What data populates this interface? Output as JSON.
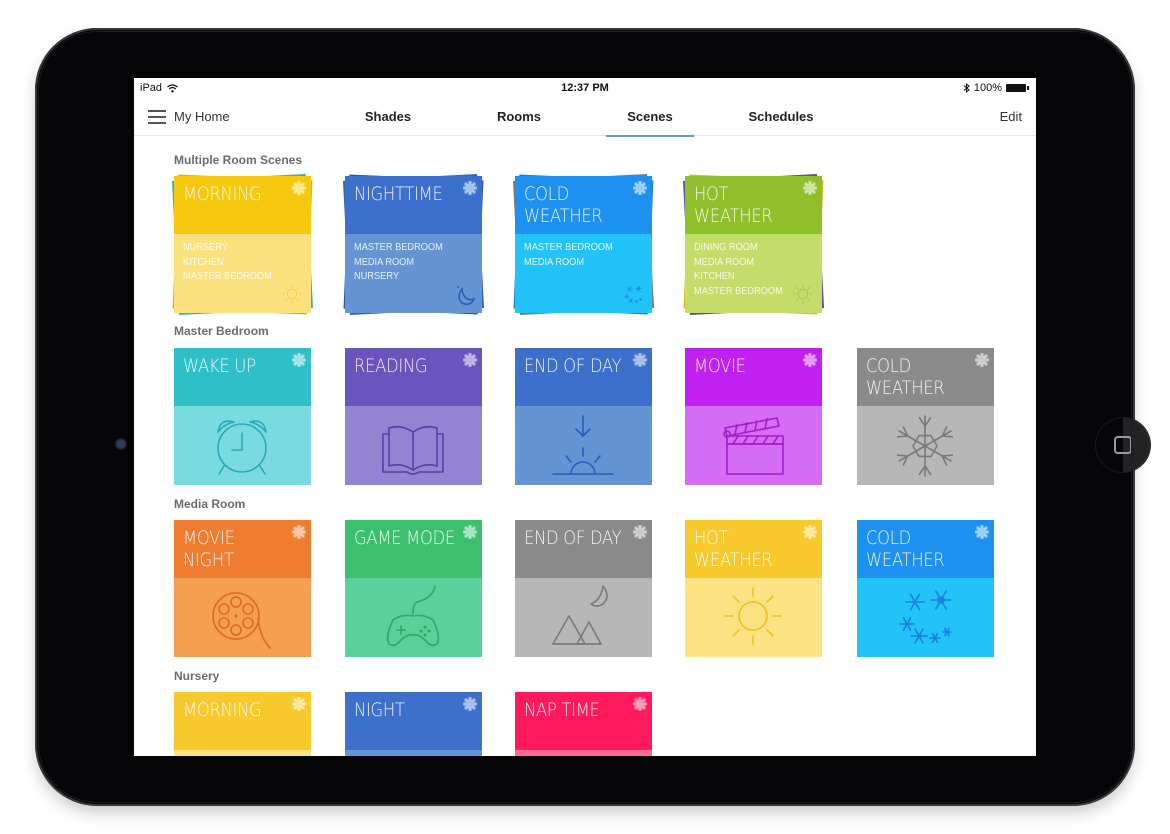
{
  "device": {
    "model": "iPad"
  },
  "statusbar": {
    "carrier": "iPad",
    "time": "12:37 PM",
    "battery": "100%"
  },
  "navbar": {
    "home_label": "My Home",
    "tabs": [
      {
        "label": "Shades",
        "active": false
      },
      {
        "label": "Rooms",
        "active": false
      },
      {
        "label": "Scenes",
        "active": true
      },
      {
        "label": "Schedules",
        "active": false
      }
    ],
    "edit_label": "Edit"
  },
  "sections": [
    {
      "label": "Multiple Room Scenes",
      "scenes": [
        {
          "title": [
            "MORNING"
          ],
          "rooms": [
            "NURSERY",
            "KITCHEN",
            "MASTER BEDROOM"
          ],
          "icon": "sun-icon",
          "header_color": "#f6c90e",
          "body_color": "#fbe17e",
          "back_colors": [
            "#2bb7c2",
            "#dcae1a"
          ]
        },
        {
          "title": [
            "NIGHTTIME"
          ],
          "rooms": [
            "MASTER BEDROOM",
            "MEDIA ROOM",
            "NURSERY"
          ],
          "icon": "moon-icon",
          "header_color": "#3d6fcc",
          "body_color": "#6494d4",
          "back_colors": [
            "#3563b8",
            "#2f59a8"
          ]
        },
        {
          "title": [
            "COLD",
            "WEATHER"
          ],
          "rooms": [
            "MASTER BEDROOM",
            "MEDIA ROOM"
          ],
          "icon": "snowflakes-icon",
          "header_color": "#1e90f0",
          "body_color": "#22c3f8",
          "back_colors": [
            "#7a7a7a",
            "#1a80e0"
          ]
        },
        {
          "title": [
            "HOT",
            "WEATHER"
          ],
          "rooms": [
            "DINING ROOM",
            "MEDIA ROOM",
            "KITCHEN",
            "MASTER BEDROOM"
          ],
          "icon": "sun-icon",
          "header_color": "#8fbf2a",
          "body_color": "#c4dc6a",
          "back_colors": [
            "#5b4db3",
            "#e2b51c"
          ]
        }
      ]
    },
    {
      "label": "Master Bedroom",
      "scenes": [
        {
          "title": [
            "WAKE UP"
          ],
          "icon": "alarm-clock-icon",
          "header_color": "#2fbfc9",
          "body_color": "#79dbe0",
          "line_color": "#2aa9b4"
        },
        {
          "title": [
            "READING"
          ],
          "icon": "book-icon",
          "header_color": "#6a55bf",
          "body_color": "#9384d2",
          "line_color": "#5340a8"
        },
        {
          "title": [
            "END OF DAY"
          ],
          "icon": "sunset-icon",
          "header_color": "#3d6fcc",
          "body_color": "#6494d4",
          "line_color": "#2d5cb8"
        },
        {
          "title": [
            "MOVIE"
          ],
          "icon": "clapperboard-icon",
          "header_color": "#c020f0",
          "body_color": "#d46cf4",
          "line_color": "#a01cd0"
        },
        {
          "title": [
            "COLD",
            "WEATHER"
          ],
          "icon": "snowflake-icon",
          "header_color": "#8a8a8a",
          "body_color": "#b7b7b7",
          "line_color": "#7a7a7a"
        }
      ]
    },
    {
      "label": "Media Room",
      "scenes": [
        {
          "title": [
            "MOVIE",
            "NIGHT"
          ],
          "icon": "film-reel-icon",
          "header_color": "#f07c30",
          "body_color": "#f4a050",
          "line_color": "#d86a24"
        },
        {
          "title": [
            "GAME MODE"
          ],
          "icon": "gamepad-icon",
          "header_color": "#3cc070",
          "body_color": "#5ad09a",
          "line_color": "#30a860"
        },
        {
          "title": [
            "END OF DAY"
          ],
          "icon": "moon-mountains-icon",
          "header_color": "#8a8a8a",
          "body_color": "#b7b7b7",
          "line_color": "#7a7a7a"
        },
        {
          "title": [
            "HOT",
            "WEATHER"
          ],
          "icon": "sun-icon",
          "header_color": "#f7c92c",
          "body_color": "#fbe282",
          "line_color": "#f0c020"
        },
        {
          "title": [
            "COLD",
            "WEATHER"
          ],
          "icon": "snowflakes-icon",
          "header_color": "#1e90f0",
          "body_color": "#22c3f8",
          "line_color": "#1a80e0"
        }
      ]
    },
    {
      "label": "Nursery",
      "scenes": [
        {
          "title": [
            "MORNING"
          ],
          "icon": "",
          "header_color": "#f7c92c",
          "body_color": "#fbe282",
          "line_color": "#f0c020"
        },
        {
          "title": [
            "NIGHT"
          ],
          "icon": "",
          "header_color": "#3d6fcc",
          "body_color": "#6494d4",
          "line_color": "#2d5cb8"
        },
        {
          "title": [
            "NAP TIME"
          ],
          "icon": "",
          "header_color": "#fc1a5c",
          "body_color": "#fd6a94",
          "line_color": "#e0104c"
        }
      ]
    }
  ]
}
